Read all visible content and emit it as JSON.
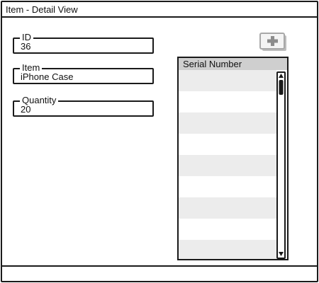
{
  "window": {
    "title": "Item - Detail View"
  },
  "form": {
    "id": {
      "label": "ID",
      "value": "36"
    },
    "item": {
      "label": "Item",
      "value": "iPhone Case"
    },
    "quantity": {
      "label": "Quantity",
      "value": "20"
    }
  },
  "toolbar": {
    "add_icon": "plus-icon"
  },
  "serial_list": {
    "header": "Serial Number",
    "rows": [
      "",
      "",
      "",
      "",
      "",
      "",
      "",
      "",
      ""
    ]
  },
  "status_bar": {
    "text": ""
  }
}
